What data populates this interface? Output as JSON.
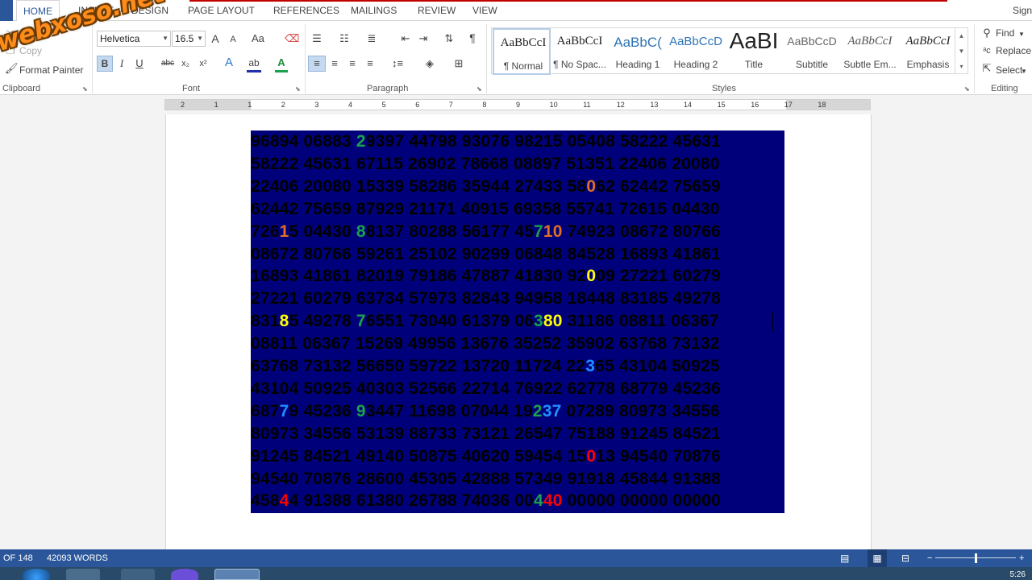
{
  "tabs": [
    {
      "label": "HOME",
      "active": true
    },
    {
      "label": "INSERT"
    },
    {
      "label": "DESIGN"
    },
    {
      "label": "PAGE LAYOUT"
    },
    {
      "label": "REFERENCES"
    },
    {
      "label": "MAILINGS"
    },
    {
      "label": "REVIEW"
    },
    {
      "label": "VIEW"
    }
  ],
  "signin": "Sign",
  "watermark": "webxoso.net",
  "clipboard": {
    "cut": "Cut",
    "copy": "Copy",
    "format_painter": "Format Painter",
    "label": "Clipboard"
  },
  "font": {
    "name": "Helvetica",
    "size": "16.5",
    "change_case": "Aa",
    "label": "Font"
  },
  "paragraph": {
    "label": "Paragraph"
  },
  "styles": {
    "label": "Styles",
    "items": [
      {
        "sample": "AaBbCcI",
        "name": "¶ Normal"
      },
      {
        "sample": "AaBbCcI",
        "name": "¶ No Spac..."
      },
      {
        "sample": "AaBbC(",
        "name": "Heading 1"
      },
      {
        "sample": "AaBbCcD",
        "name": "Heading 2"
      },
      {
        "sample": "AaBI",
        "name": "Title"
      },
      {
        "sample": "AaBbCcD",
        "name": "Subtitle"
      },
      {
        "sample": "AaBbCcI",
        "name": "Subtle Em..."
      },
      {
        "sample": "AaBbCcI",
        "name": "Emphasis"
      }
    ]
  },
  "editing": {
    "find": "Find",
    "replace": "Replace",
    "select": "Select",
    "label": "Editing"
  },
  "ruler_numbers": [
    "2",
    "1",
    "1",
    "2",
    "3",
    "4",
    "5",
    "6",
    "7",
    "8",
    "9",
    "10",
    "11",
    "12",
    "13",
    "14",
    "15",
    "16",
    "17",
    "18"
  ],
  "colors": {
    "ribbon_blue": "#2b579a",
    "block_bg": "#00007a",
    "green": "#1aa34a",
    "orange": "#e07020",
    "yellow": "#ffff00",
    "cyan": "#1e90ff",
    "red": "#ff0000"
  },
  "number_rows": [
    [
      {
        "t": "96894 06883 "
      },
      {
        "t": "2",
        "c": "green"
      },
      {
        "t": "9397 44798 93076 98215 05408 58222 45631"
      }
    ],
    [
      {
        "t": "58222 45631 67115 26902 78668 08897 51351 22406 20080"
      }
    ],
    [
      {
        "t": "22406 20080 15339 58286 35944 27433 58"
      },
      {
        "t": "0",
        "c": "orange"
      },
      {
        "t": "62 62442 75659"
      }
    ],
    [
      {
        "t": "62442 75659 87929 21171 40915 69358 55741 72615 04430"
      }
    ],
    [
      {
        "t": "726"
      },
      {
        "t": "1",
        "c": "orange"
      },
      {
        "t": "5 04430 "
      },
      {
        "t": "8",
        "c": "green"
      },
      {
        "t": "8137 80288 56177 45"
      },
      {
        "t": "7",
        "c": "green"
      },
      {
        "t": "10",
        "c": "orange"
      },
      {
        "t": " 74923 08672 80766"
      }
    ],
    [
      {
        "t": "08672 80766 59261 25102 90299 06848 84528 16893 41861"
      }
    ],
    [
      {
        "t": "16893 41861 82019 79186 47887 41830 92"
      },
      {
        "t": "0",
        "c": "yellow"
      },
      {
        "t": "09 27221 60279"
      }
    ],
    [
      {
        "t": "27221 60279 63734 57973 82843 94958 18448 83185 49278"
      }
    ],
    [
      {
        "t": "831"
      },
      {
        "t": "8",
        "c": "yellow"
      },
      {
        "t": "5 49278 "
      },
      {
        "t": "7",
        "c": "green"
      },
      {
        "t": "6551 73040 61379 06"
      },
      {
        "t": "3",
        "c": "green"
      },
      {
        "t": "80",
        "c": "yellow"
      },
      {
        "t": " 31186 08811 06367"
      }
    ],
    [
      {
        "t": "08811 06367 15269 49956 13676 35252 35902 63768 73132"
      }
    ],
    [
      {
        "t": "63768 73132 56650 59722 13720 11724 22"
      },
      {
        "t": "3",
        "c": "cyan"
      },
      {
        "t": "65 43104 50925"
      }
    ],
    [
      {
        "t": "43104 50925 40303 52566 22714 76922 62778 68779 45236"
      }
    ],
    [
      {
        "t": "687"
      },
      {
        "t": "7",
        "c": "cyan"
      },
      {
        "t": "9 45236 "
      },
      {
        "t": "9",
        "c": "green"
      },
      {
        "t": "3447 11698 07044 19"
      },
      {
        "t": "2",
        "c": "green"
      },
      {
        "t": "37",
        "c": "cyan"
      },
      {
        "t": " 07289 80973 34556"
      }
    ],
    [
      {
        "t": "80973 34556 53139 88733 73121 26547 75188 91245 84521"
      }
    ],
    [
      {
        "t": "91245 84521 49140 50875 40620 59454 15"
      },
      {
        "t": "0",
        "c": "red"
      },
      {
        "t": "13 94540 70876"
      }
    ],
    [
      {
        "t": "94540 70876 28600 45305 42888 57349 91918 45844 91388"
      }
    ],
    [
      {
        "t": "458"
      },
      {
        "t": "4",
        "c": "red"
      },
      {
        "t": "4 91388 61380 26788 74036 00"
      },
      {
        "t": "4",
        "c": "green"
      },
      {
        "t": "40",
        "c": "red"
      },
      {
        "t": " 00000 00000 00000"
      }
    ]
  ],
  "status": {
    "page": "OF 148",
    "words": "42093 WORDS"
  },
  "taskbar_time": "5:26"
}
